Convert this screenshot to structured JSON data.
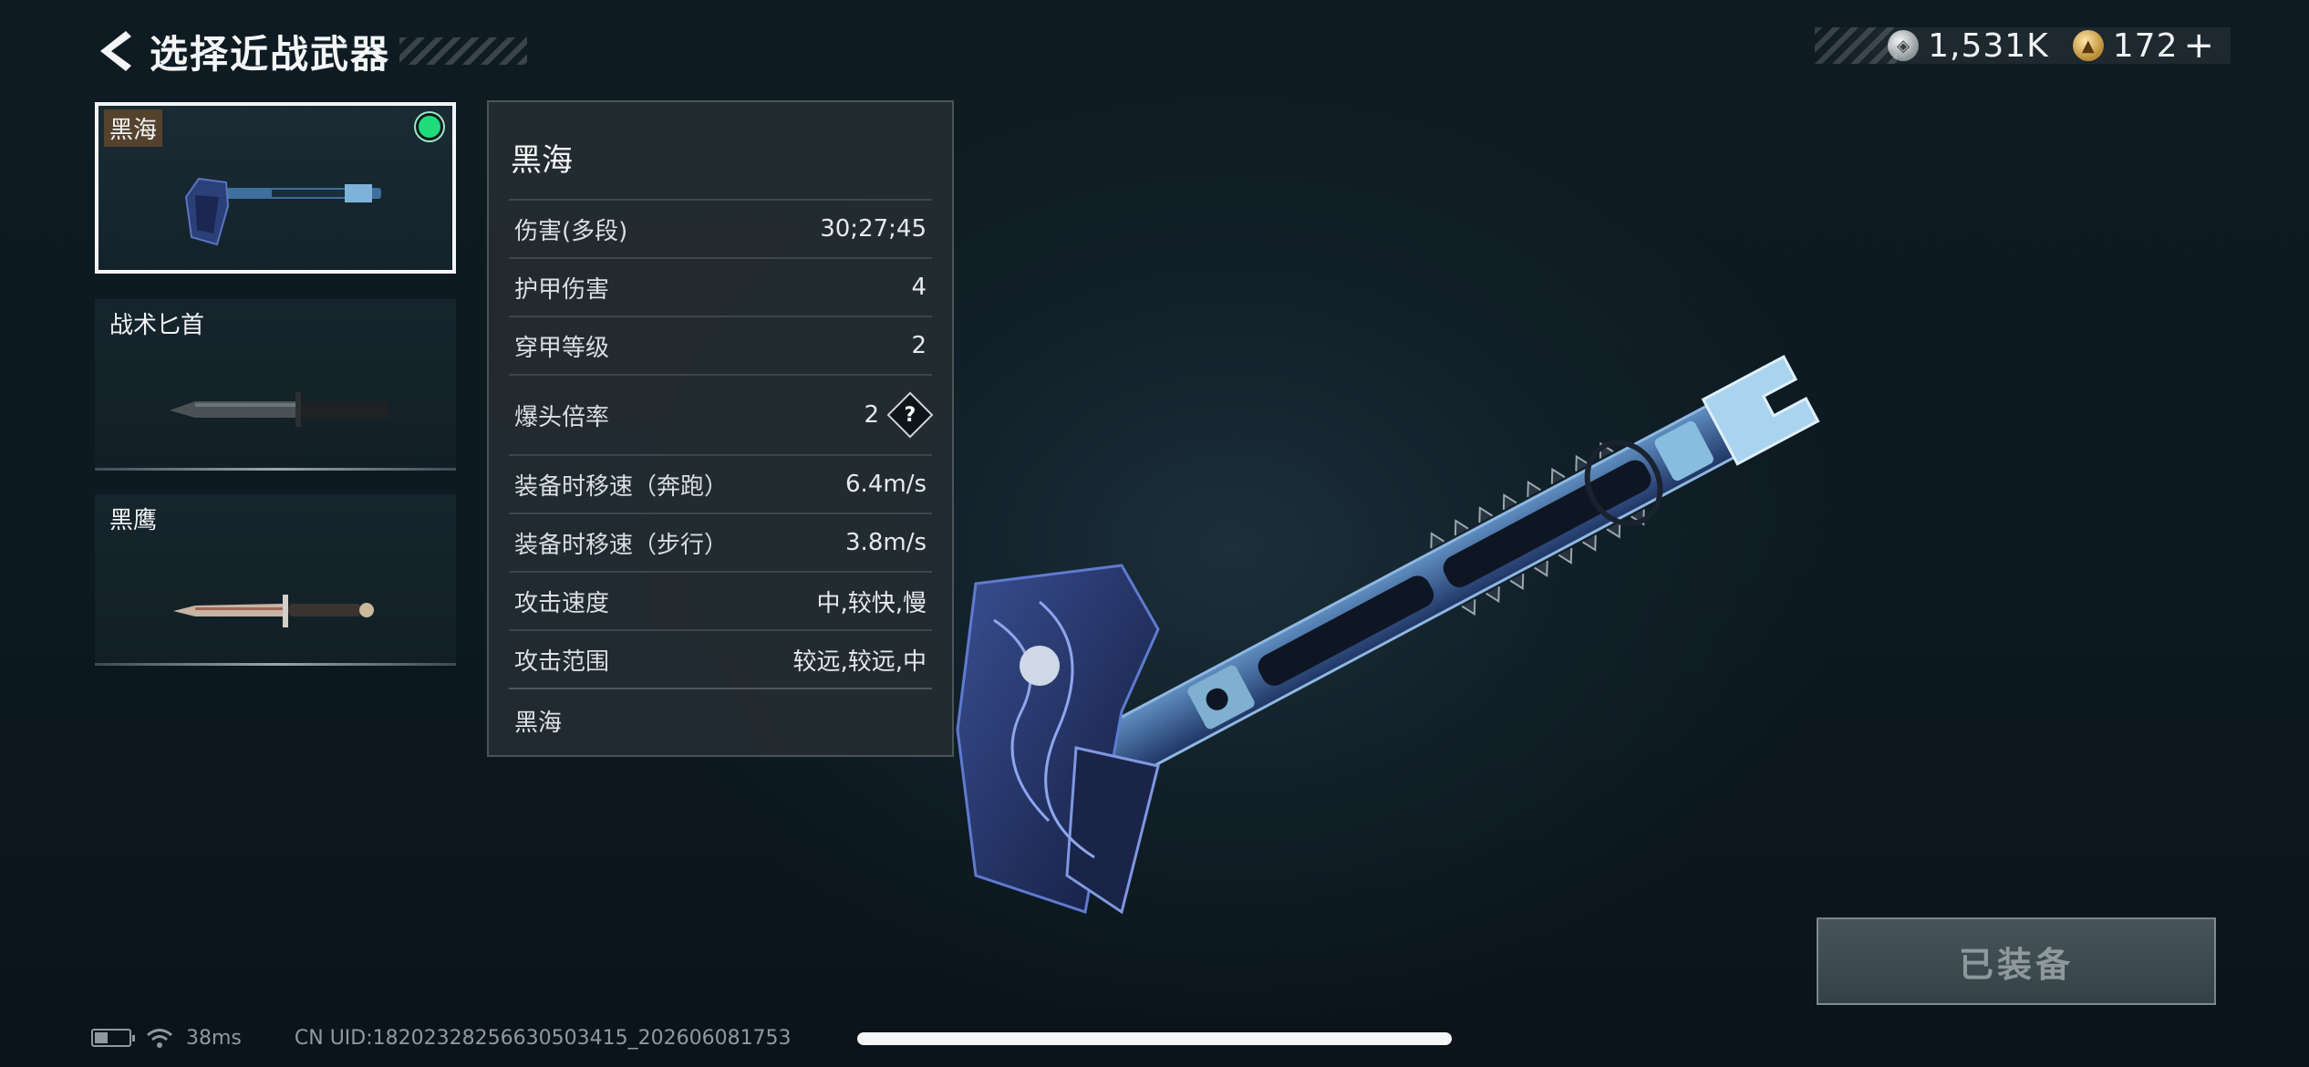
{
  "header": {
    "back_icon": "chevron-left-icon",
    "title": "选择近战武器"
  },
  "currency": {
    "silver": {
      "icon": "silver-coin-icon",
      "value": "1,531K"
    },
    "gold": {
      "icon": "gold-coin-icon",
      "value": "172"
    },
    "plus_label": "+"
  },
  "weapons": [
    {
      "label": "黑海",
      "selected": true,
      "equipped": true
    },
    {
      "label": "战术匕首",
      "selected": false,
      "equipped": false
    },
    {
      "label": "黑鹰",
      "selected": false,
      "equipped": false
    }
  ],
  "stats": {
    "title": "黑海",
    "rows": [
      {
        "label": "伤害(多段)",
        "value": "30;27;45"
      },
      {
        "label": "护甲伤害",
        "value": "4"
      },
      {
        "label": "穿甲等级",
        "value": "2"
      },
      {
        "label": "爆头倍率",
        "value": "2",
        "help": "?"
      },
      {
        "label": "装备时移速（奔跑）",
        "value": "6.4m/s"
      },
      {
        "label": "装备时移速（步行）",
        "value": "3.8m/s"
      },
      {
        "label": "攻击速度",
        "value": "中,较快,慢"
      },
      {
        "label": "攻击范围",
        "value": "较远,较远,中"
      }
    ],
    "footer": "黑海"
  },
  "equip_button": {
    "label": "已装备"
  },
  "status_bar": {
    "ping": "38ms",
    "uid": "CN UID:18202328256630503415_202606081753"
  },
  "colors": {
    "equipped_dot": "#1fdc7a",
    "background": "#0d1a21",
    "panel": "#242c32"
  }
}
